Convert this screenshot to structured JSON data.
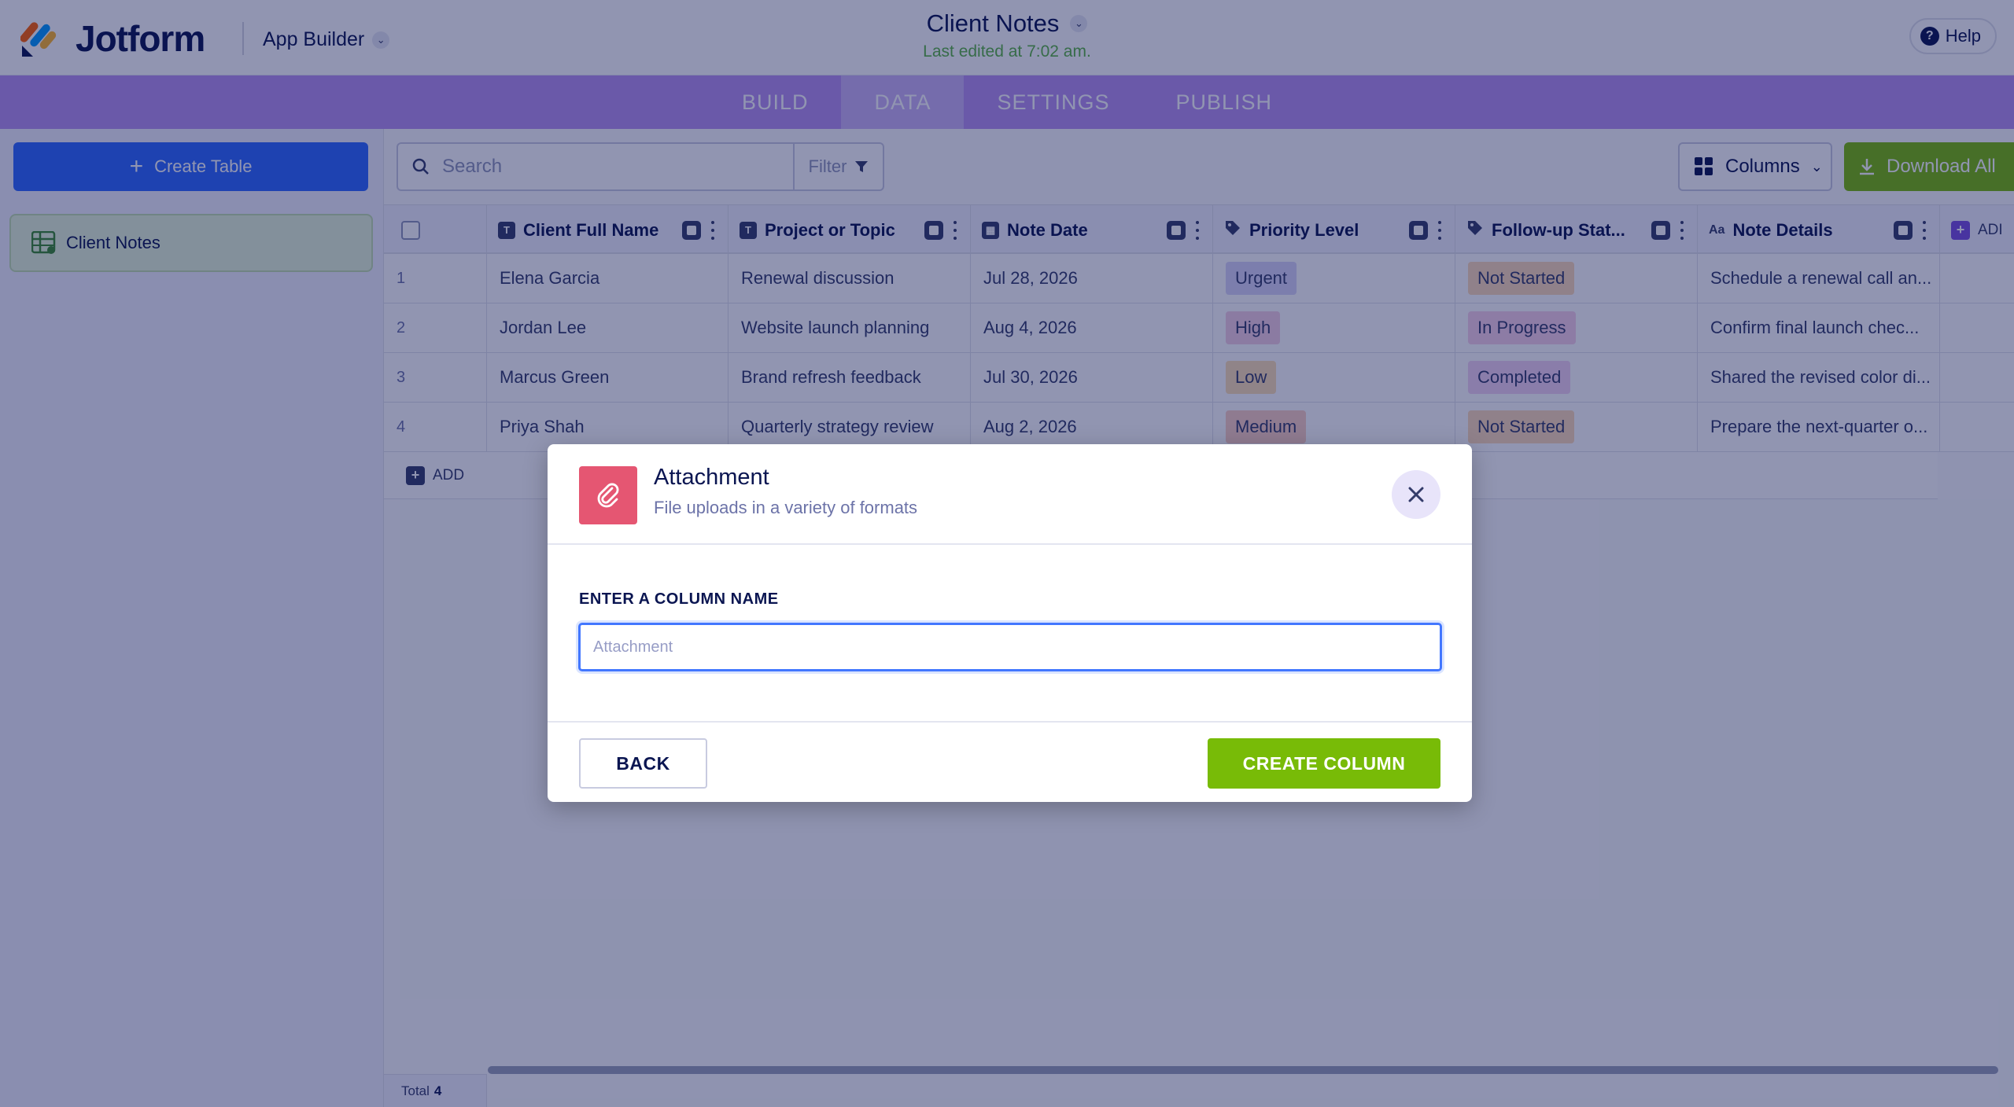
{
  "header": {
    "logo_text": "Jotform",
    "app_builder_label": "App Builder",
    "title": "Client Notes",
    "subtitle": "Last edited at 7:02 am.",
    "help_label": "Help"
  },
  "nav": {
    "tabs": [
      {
        "label": "BUILD",
        "active": false
      },
      {
        "label": "DATA",
        "active": true
      },
      {
        "label": "SETTINGS",
        "active": false
      },
      {
        "label": "PUBLISH",
        "active": false
      }
    ]
  },
  "sidebar": {
    "create_table_label": "Create Table",
    "tables": [
      {
        "label": "Client Notes",
        "active": true
      }
    ]
  },
  "toolbar": {
    "search_placeholder": "Search",
    "filter_label": "Filter",
    "columns_label": "Columns",
    "download_label": "Download All"
  },
  "table": {
    "columns": [
      {
        "label": "Client Full Name",
        "icon": "T"
      },
      {
        "label": "Project or Topic",
        "icon": "T"
      },
      {
        "label": "Note Date",
        "icon": "calendar"
      },
      {
        "label": "Priority Level",
        "icon": "tag"
      },
      {
        "label": "Follow-up Stat...",
        "icon": "tag"
      },
      {
        "label": "Note Details",
        "icon": "Aa"
      }
    ],
    "add_column_label": "ADI",
    "rows": [
      {
        "num": "1",
        "name": "Elena Garcia",
        "topic": "Renewal discussion",
        "date": "Jul 28, 2026",
        "priority": "Urgent",
        "status": "Not Started",
        "details": "Schedule a renewal call an..."
      },
      {
        "num": "2",
        "name": "Jordan Lee",
        "topic": "Website launch planning",
        "date": "Aug 4, 2026",
        "priority": "High",
        "status": "In Progress",
        "details": "Confirm final launch chec..."
      },
      {
        "num": "3",
        "name": "Marcus Green",
        "topic": "Brand refresh feedback",
        "date": "Jul 30, 2026",
        "priority": "Low",
        "status": "Completed",
        "details": "Shared the revised color di..."
      },
      {
        "num": "4",
        "name": "Priya Shah",
        "topic": "Quarterly strategy review",
        "date": "Aug 2, 2026",
        "priority": "Medium",
        "status": "Not Started",
        "details": "Prepare the next-quarter o..."
      }
    ],
    "add_row_label": "ADD",
    "total_label": "Total",
    "total_value": "4"
  },
  "pill_colors": {
    "Urgent": "#d9d6f7",
    "High": "#f5cfe3",
    "Low": "#fde1b5",
    "Medium": "#fbcfc4",
    "Not Started": "#fddbb8",
    "In Progress": "#f8d2ea",
    "Completed": "#f3d3f3"
  },
  "modal": {
    "title": "Attachment",
    "subtitle": "File uploads in a variety of formats",
    "field_label": "ENTER A COLUMN NAME",
    "input_placeholder": "Attachment",
    "input_value": "",
    "back_label": "BACK",
    "create_label": "CREATE COLUMN",
    "icon": "paperclip-icon"
  },
  "colors": {
    "accent_purple": "#b992f0",
    "create_green": "#78bb07",
    "primary_blue": "#2e69ff",
    "attachment_red": "#e55672"
  }
}
